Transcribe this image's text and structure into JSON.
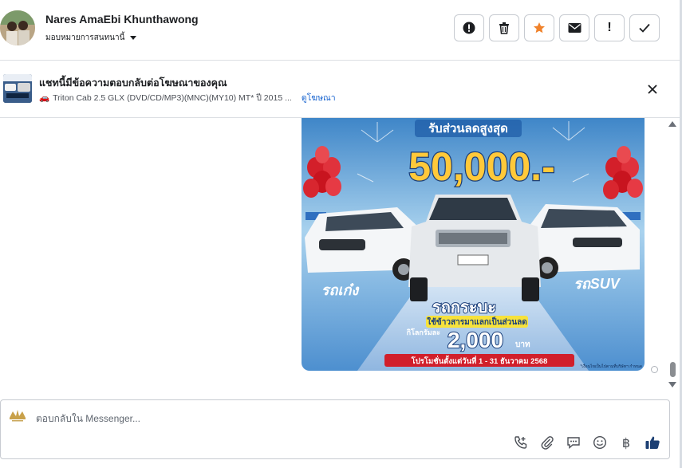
{
  "header": {
    "contact_name": "Nares AmaEbi Khunthawong",
    "assign_label": "มอบหมายการสนทนานี้",
    "actions": [
      {
        "name": "alert-circle",
        "label": "!"
      },
      {
        "name": "trash",
        "label": ""
      },
      {
        "name": "star",
        "label": ""
      },
      {
        "name": "mail",
        "label": ""
      },
      {
        "name": "exclamation",
        "label": "!"
      },
      {
        "name": "check",
        "label": ""
      }
    ]
  },
  "ad_bar": {
    "title": "แชทนี้มีข้อความตอบกลับต่อโฆษณาของคุณ",
    "ad_name": "Triton Cab 2.5 GLX (DVD/CD/MP3)(MNC)(MY10) MT* ปี 2015 ...",
    "view_ad_link": "ดูโฆษณา"
  },
  "chat": {
    "ad_image": {
      "headline": "รับส่วนลดสูงสุด",
      "amount": "50,000.-",
      "label_left": "รถเก๋ง",
      "label_right": "รถSUV",
      "label_center": "รถกระบะ",
      "ribbon_text": "ใช้ข้าวสารมาแลกเป็นส่วนลด",
      "per_kg_label": "กิโลกรัมละ",
      "per_kg_value": "2,000",
      "per_kg_unit": "บาท",
      "promo_period": "โปรโมชั่นตั้งแต่วันที่ 1 - 31 ธันวาคม 2568",
      "fine_print": "*เงื่อนไขเป็นไปตามที่บริษัทฯ กำหนด"
    }
  },
  "composer": {
    "placeholder": "ตอบกลับใน Messenger...",
    "tools": [
      "phone-add-icon",
      "paperclip-icon",
      "chat-bubble-icon",
      "emoji-icon",
      "baht-icon",
      "thumbs-up-icon"
    ],
    "baht_symbol": "฿"
  },
  "colors": {
    "accent_blue": "#1763cf",
    "star_orange": "#f0822b",
    "border": "#c7cbd1"
  }
}
